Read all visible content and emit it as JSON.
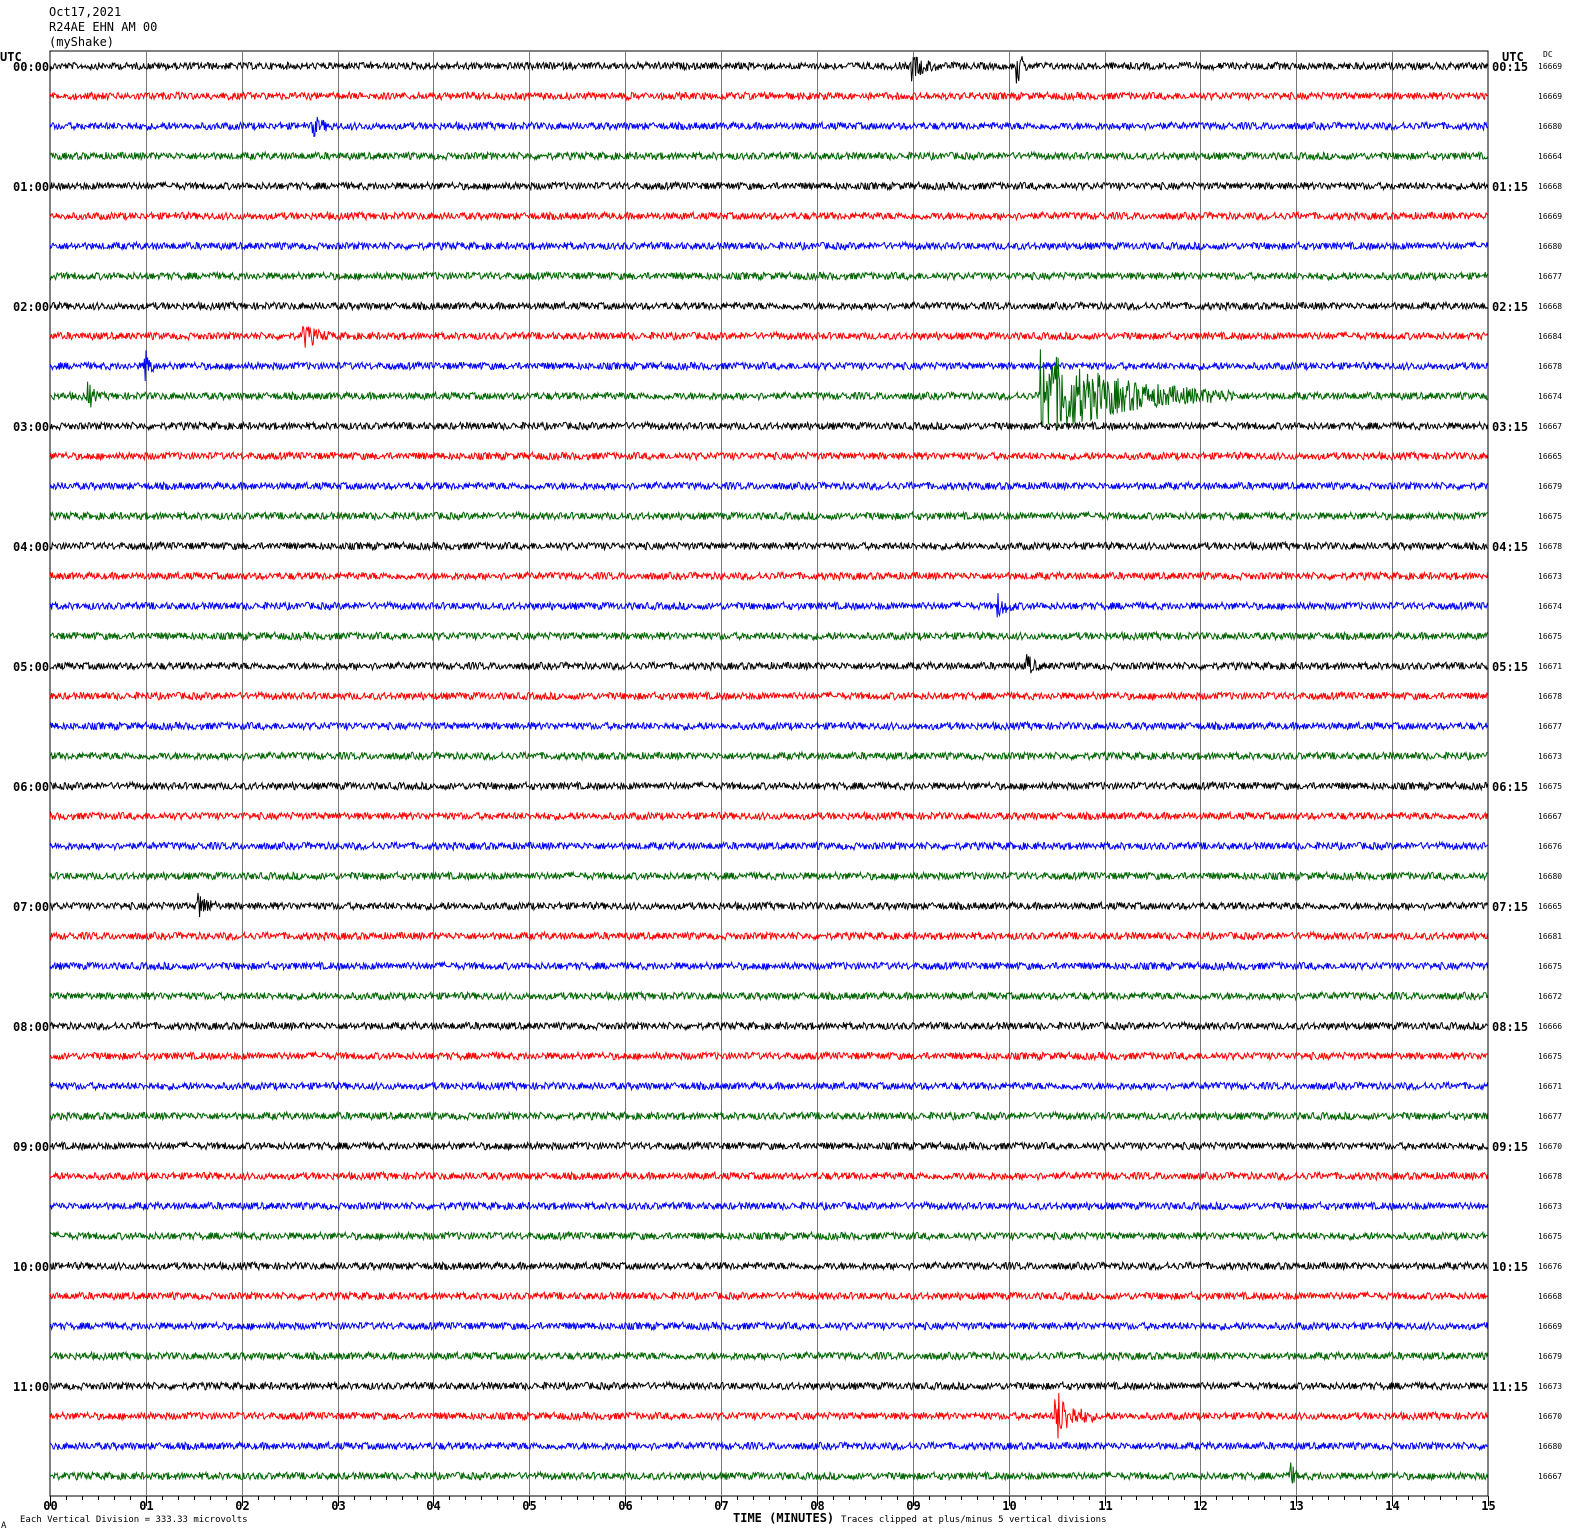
{
  "header": {
    "date": "Oct17,2021",
    "station": "R24AE EHN AM 00",
    "network": "(myShake)"
  },
  "left_axis_label": "UTC",
  "right_axis_label": "UTC",
  "dc_label": "DC",
  "footer": {
    "scale_note": "Each Vertical Division =  333.33 microvolts",
    "x_axis_title": "TIME (MINUTES)",
    "clip_note": "Traces clipped at plus/minus 5 vertical divisions",
    "corner_mark": "A"
  },
  "colors": {
    "trace_cycle": [
      "#000000",
      "#ff0000",
      "#0000ff",
      "#006400"
    ],
    "grid": "#000000",
    "background": "#ffffff"
  },
  "chart_data": {
    "type": "line",
    "title": "",
    "xlabel": "TIME (MINUTES)",
    "ylabel": "",
    "xlim": [
      0,
      15
    ],
    "x_ticks": [
      "00",
      "01",
      "02",
      "03",
      "04",
      "05",
      "06",
      "07",
      "08",
      "09",
      "10",
      "11",
      "12",
      "13",
      "14",
      "15"
    ],
    "grid": "vertical lines every 1 minute",
    "trace_minutes": 15,
    "left_hour_labels": [
      "00:00",
      "01:00",
      "02:00",
      "03:00",
      "04:00",
      "05:00",
      "06:00",
      "07:00",
      "08:00",
      "09:00",
      "10:00",
      "11:00"
    ],
    "right_hour_labels": [
      "00:15",
      "01:15",
      "02:15",
      "03:15",
      "04:15",
      "05:15",
      "06:15",
      "07:15",
      "08:15",
      "09:15",
      "10:15",
      "11:15"
    ],
    "dc_values": [
      "16669",
      "16669",
      "16680",
      "16664",
      "16668",
      "16669",
      "16680",
      "16677",
      "16668",
      "16684",
      "16678",
      "16674",
      "16667",
      "16665",
      "16679",
      "16675",
      "16678",
      "16673",
      "16674",
      "16675",
      "16671",
      "16678",
      "16677",
      "16673",
      "16675",
      "16667",
      "16676",
      "16680",
      "16665",
      "16681",
      "16675",
      "16672",
      "16666",
      "16675",
      "16671",
      "16677",
      "16670",
      "16678",
      "16673",
      "16675",
      "16676",
      "16668",
      "16669",
      "16679",
      "16673",
      "16670",
      "16680",
      "16667"
    ],
    "events": [
      {
        "row": 11,
        "minute": 10.35,
        "amplitude": 1.0,
        "duration_minutes": 2.0
      },
      {
        "row": 45,
        "minute": 10.5,
        "amplitude": 0.55,
        "duration_minutes": 0.4
      },
      {
        "row": 0,
        "minute": 10.1,
        "amplitude": 0.35,
        "duration_minutes": 0.1
      },
      {
        "row": 0,
        "minute": 9.0,
        "amplitude": 0.25,
        "duration_minutes": 0.3
      },
      {
        "row": 9,
        "minute": 2.65,
        "amplitude": 0.25,
        "duration_minutes": 0.3
      },
      {
        "row": 10,
        "minute": 1.0,
        "amplitude": 0.35,
        "duration_minutes": 0.1
      },
      {
        "row": 11,
        "minute": 0.4,
        "amplitude": 0.3,
        "duration_minutes": 0.1
      },
      {
        "row": 28,
        "minute": 1.55,
        "amplitude": 0.3,
        "duration_minutes": 0.2
      },
      {
        "row": 20,
        "minute": 10.2,
        "amplitude": 0.2,
        "duration_minutes": 0.15
      },
      {
        "row": 2,
        "minute": 2.75,
        "amplitude": 0.2,
        "duration_minutes": 0.2
      },
      {
        "row": 18,
        "minute": 9.9,
        "amplitude": 0.2,
        "duration_minutes": 0.2
      },
      {
        "row": 47,
        "minute": 12.95,
        "amplitude": 0.2,
        "duration_minutes": 0.1
      }
    ]
  }
}
